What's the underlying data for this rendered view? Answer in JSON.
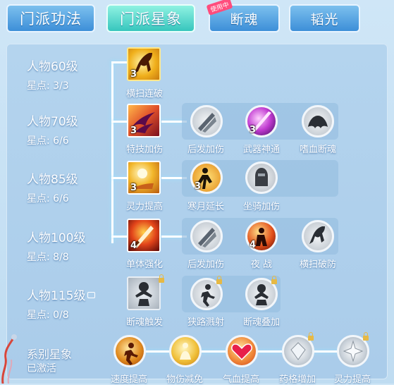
{
  "tabs": [
    {
      "label": "门派功法"
    },
    {
      "label": "门派星象"
    },
    {
      "label": "断魂",
      "badge": "使用中"
    },
    {
      "label": "韬光"
    }
  ],
  "levels": [
    {
      "title": "人物60级",
      "stars": "星点: 3/3"
    },
    {
      "title": "人物70级",
      "stars": "星点: 6/6"
    },
    {
      "title": "人物85级",
      "stars": "星点: 6/6"
    },
    {
      "title": "人物100级",
      "stars": "星点: 8/8"
    },
    {
      "title": "人物115级",
      "stars": "星点: 0/8"
    }
  ],
  "nodes": {
    "r1": {
      "main": {
        "label": "横扫连破",
        "count": "3"
      }
    },
    "r2": {
      "main": {
        "label": "特技加伤",
        "count": "3"
      },
      "subs": [
        {
          "label": "后发加伤",
          "count": ""
        },
        {
          "label": "武器神通",
          "count": "3"
        },
        {
          "label": "嗜血断魂",
          "count": ""
        }
      ]
    },
    "r3": {
      "main": {
        "label": "灵力提高",
        "count": "3"
      },
      "subs": [
        {
          "label": "寒月延长",
          "count": "3"
        },
        {
          "label": "坐骑加伤",
          "count": ""
        }
      ]
    },
    "r4": {
      "main": {
        "label": "单体强化",
        "count": "4"
      },
      "subs": [
        {
          "label": "后发加伤",
          "count": ""
        },
        {
          "label": "夜 战",
          "count": "4"
        },
        {
          "label": "横扫破防",
          "count": ""
        }
      ]
    },
    "r5": {
      "main": {
        "label": "断魂触发",
        "count": ""
      },
      "subs": [
        {
          "label": "狭路溅射",
          "count": ""
        },
        {
          "label": "断魂叠加",
          "count": ""
        }
      ]
    }
  },
  "system": {
    "title": "系别星象",
    "status": "已激活",
    "items": [
      {
        "label": "速度提高"
      },
      {
        "label": "物伤减免"
      },
      {
        "label": "气血提高"
      },
      {
        "label": "药格增加"
      },
      {
        "label": "灵力提高"
      }
    ]
  },
  "colors": {
    "tab_active": "#37c6bd",
    "tab_normal": "#3d8fd8",
    "panel": "#aaccea",
    "locked": "#e6b945"
  }
}
